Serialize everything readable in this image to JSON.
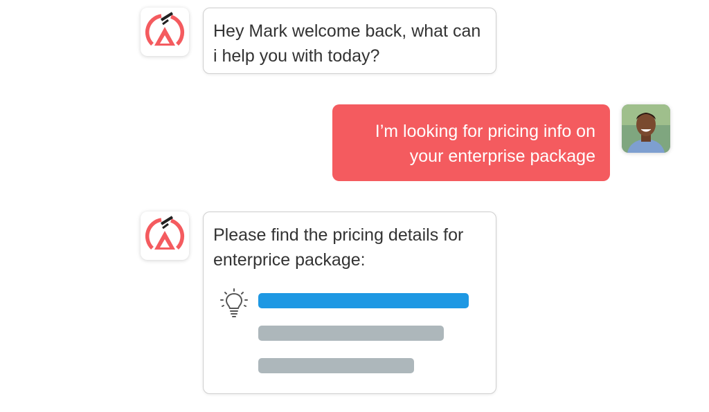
{
  "conversation": {
    "messages": [
      {
        "sender": "bot",
        "text": "Hey Mark welcome back, what can i help you with today?"
      },
      {
        "sender": "user",
        "text": "I’m looking for pricing info on your enterprise package"
      },
      {
        "sender": "bot",
        "text": "Please find the pricing details for enterprice package:"
      }
    ],
    "pricing_bars": [
      {
        "color": "#1e98e3"
      },
      {
        "color": "#adb7bb"
      },
      {
        "color": "#adb7bb"
      }
    ]
  },
  "icons": {
    "bot_avatar": "bot-logo-icon",
    "user_avatar": "user-photo",
    "pricing": "lightbulb-icon"
  },
  "colors": {
    "accent": "#f45b5f",
    "bar_primary": "#1e98e3",
    "bar_secondary": "#adb7bb",
    "bot_text": "#333333"
  }
}
